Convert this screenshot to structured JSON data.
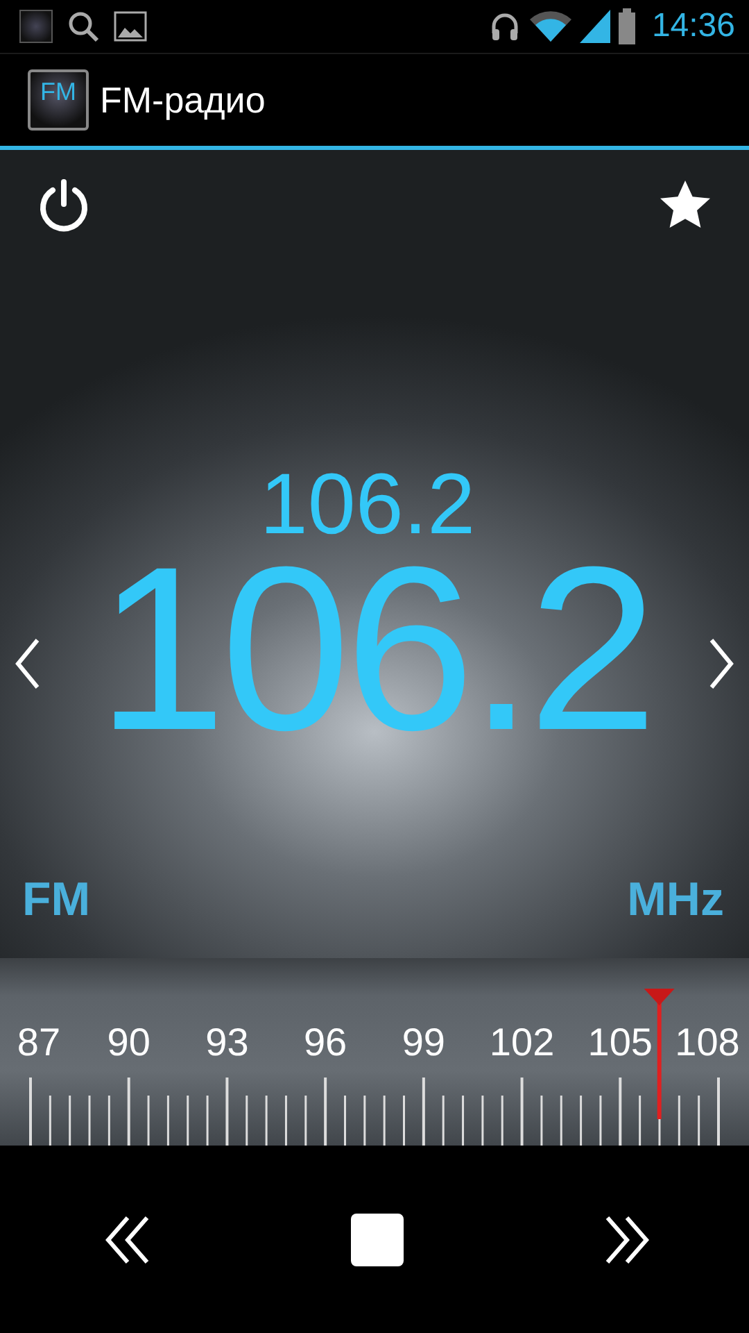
{
  "status_bar": {
    "time": "14:36"
  },
  "action_bar": {
    "title": "FM-радио",
    "app_icon_text": "FM"
  },
  "tuner": {
    "frequency": "106.2",
    "large_frequency": "106.2",
    "band": "FM",
    "unit": "MHz"
  },
  "dial": {
    "labels": [
      "87",
      "90",
      "93",
      "96",
      "99",
      "102",
      "105",
      "108"
    ],
    "level": 0.914
  }
}
